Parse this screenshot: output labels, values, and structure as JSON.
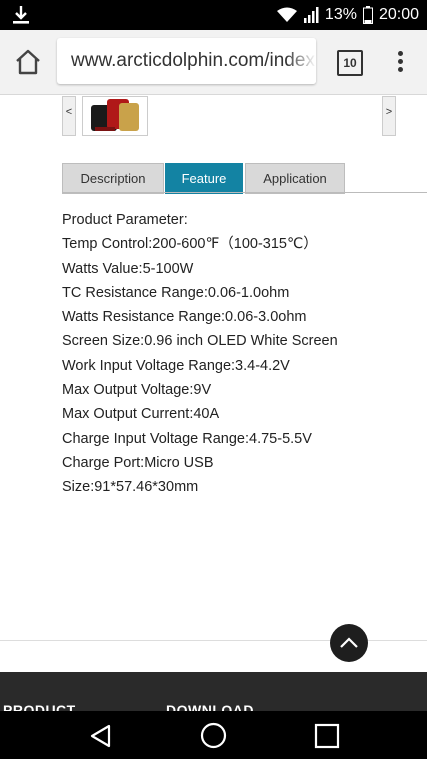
{
  "status_bar": {
    "battery": "13%",
    "time": "20:00"
  },
  "browser": {
    "url": "www.arcticdolphin.com/index",
    "tab_count": "10"
  },
  "carousel": {
    "prev": "<",
    "next": ">"
  },
  "tabs": [
    {
      "label": "Description"
    },
    {
      "label": "Feature"
    },
    {
      "label": "Application"
    }
  ],
  "active_tab": "Feature",
  "params": [
    "Product Parameter:",
    "Temp Control:200-600℉（100-315℃）",
    "Watts Value:5-100W",
    "TC Resistance Range:0.06-1.0ohm",
    "Watts Resistance Range:0.06-3.0ohm",
    "Screen Size:0.96 inch OLED White Screen",
    "Work Input Voltage Range:3.4-4.2V",
    "Max Output Voltage:9V",
    "Max Output Current:40A",
    "Charge Input Voltage Range:4.75-5.5V",
    "Charge Port:Micro USB",
    "Size:91*57.46*30mm"
  ],
  "footer": {
    "left": "PRODUCT",
    "right": "DOWNLOAD"
  },
  "colors": {
    "accent": "#1383a3",
    "footer_bg": "#2a2a2a"
  }
}
